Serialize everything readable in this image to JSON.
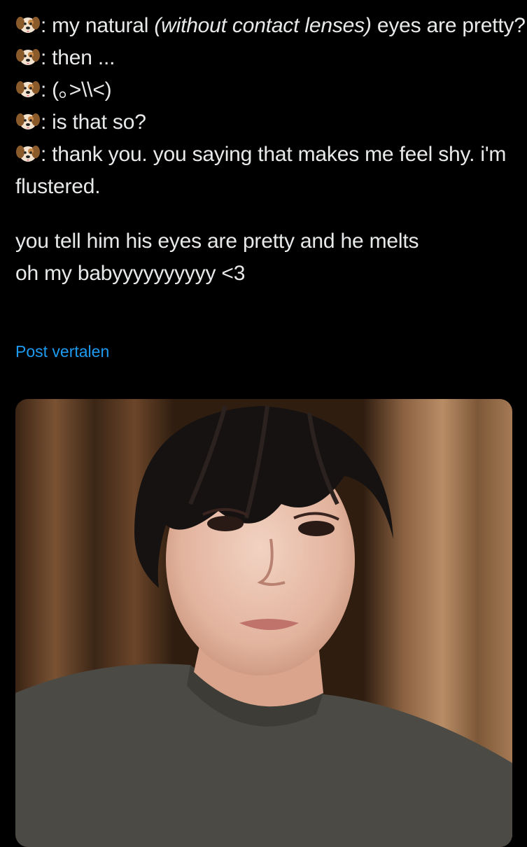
{
  "post": {
    "lines": [
      {
        "speaker_icon": "dog-face-icon",
        "sep": ":",
        "text_before": "my natural ",
        "text_italic": "(without contact lenses)",
        "text_after": " eyes are pretty?"
      },
      {
        "speaker_icon": "dog-face-icon",
        "sep": ":",
        "text": "then ..."
      },
      {
        "speaker_icon": "dog-face-icon",
        "sep": ":",
        "text": "(｡>\\\\<)"
      },
      {
        "speaker_icon": "dog-face-icon",
        "sep": ":",
        "text": "is that so?"
      },
      {
        "speaker_icon": "dog-face-icon",
        "sep": ":",
        "text": "thank you. you saying that makes me feel shy. i'm flustered."
      }
    ],
    "comment_line1": "you tell him his eyes are pretty and he melts",
    "comment_line2": "oh my babyyyyyyyyyy <3",
    "translate_link": "Post vertalen"
  },
  "colors": {
    "background": "#000000",
    "text": "#e7e9ea",
    "link": "#1d9bf0"
  }
}
